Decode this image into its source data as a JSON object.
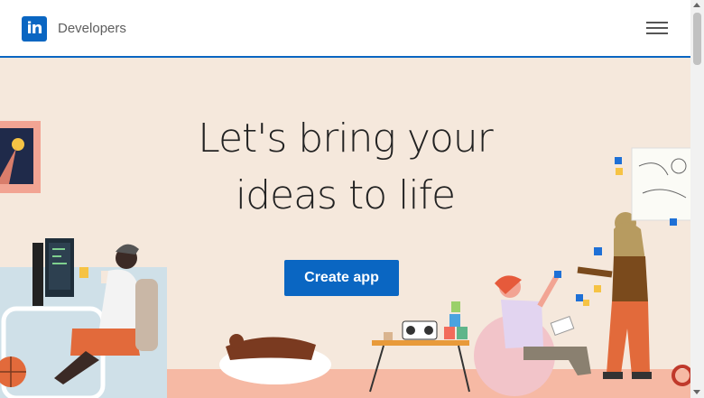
{
  "header": {
    "logo_text": "in",
    "brand": "Developers",
    "menu_icon": "hamburger-menu-icon",
    "accent": "#0a66c2"
  },
  "hero": {
    "headline_line1": "Let's bring your",
    "headline_line2": "ideas to life",
    "cta_label": "Create app",
    "background": "#f5e8dc"
  }
}
